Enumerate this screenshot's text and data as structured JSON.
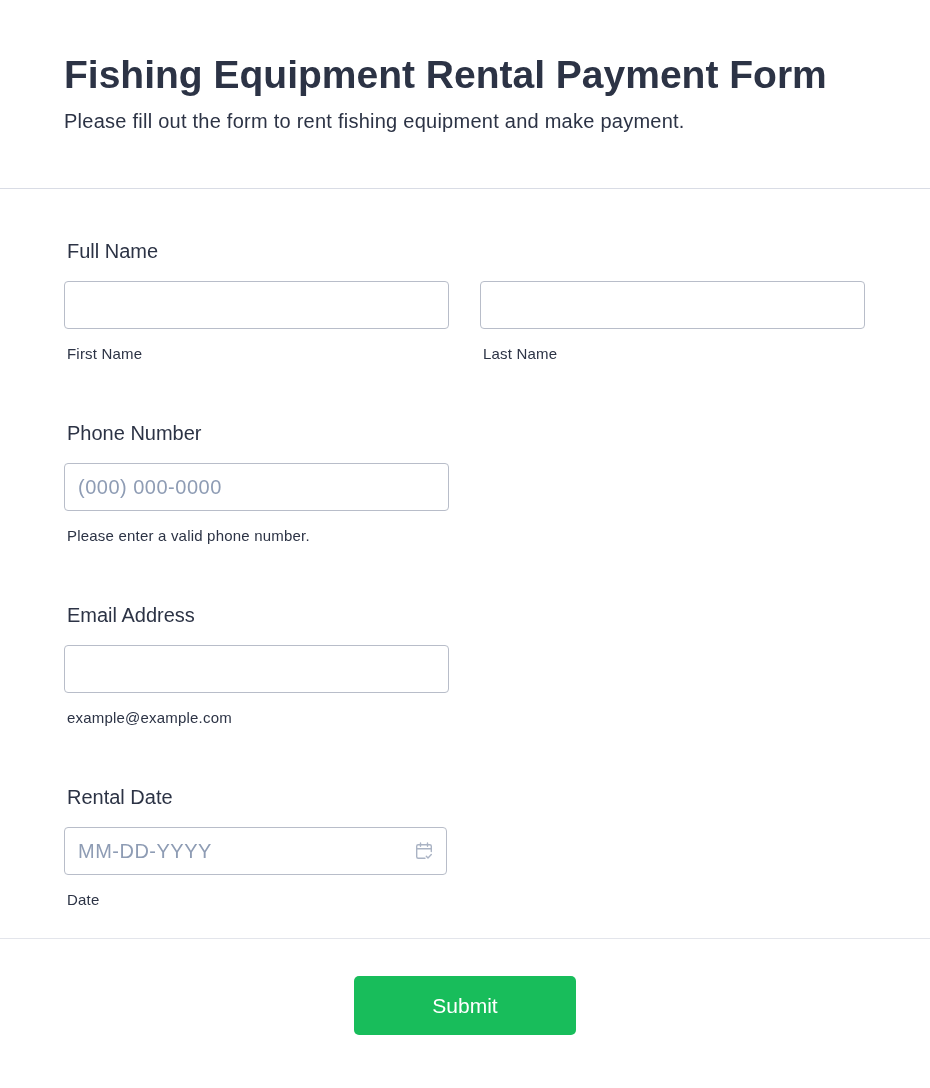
{
  "header": {
    "title": "Fishing Equipment Rental Payment Form",
    "subtitle": "Please fill out the form to rent fishing equipment and make payment."
  },
  "fields": [
    {
      "kind": "text",
      "label": "Full Name",
      "inputs": [
        {
          "sublabel": "First Name"
        },
        {
          "sublabel": "Last Name"
        }
      ]
    },
    {
      "kind": "text",
      "label": "Phone Number",
      "inputs": [
        {
          "placeholder": "(000) 000-0000",
          "sublabel": "Please enter a valid phone number."
        }
      ]
    },
    {
      "kind": "text",
      "label": "Email Address",
      "inputs": [
        {
          "sublabel": "example@example.com"
        }
      ]
    },
    {
      "kind": "date",
      "label": "Rental Date",
      "inputs": [
        {
          "placeholder": "MM-DD-YYYY",
          "sublabel": "Date"
        }
      ]
    }
  ],
  "submit_button": {
    "label": "Submit"
  }
}
